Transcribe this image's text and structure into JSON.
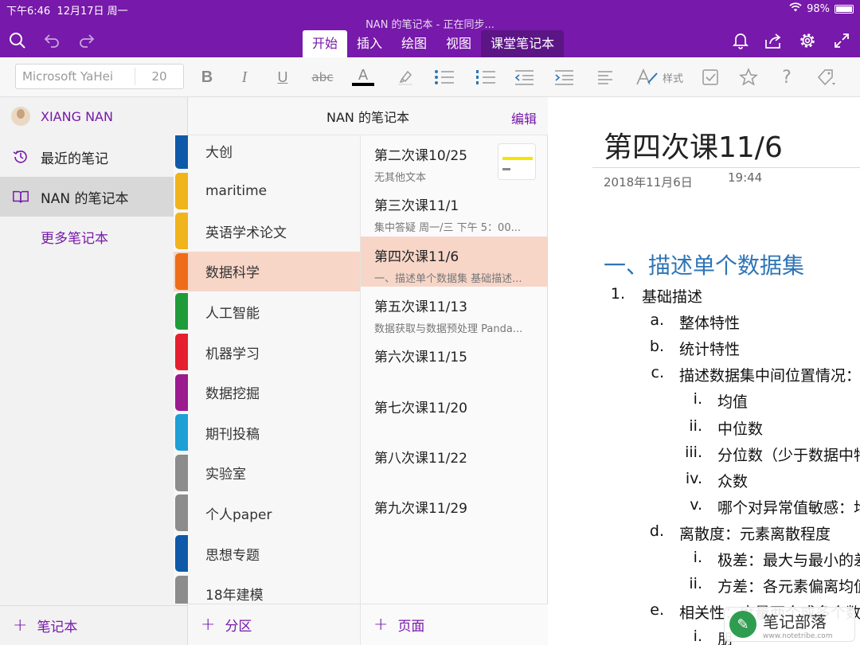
{
  "status": {
    "time": "下午6:46",
    "date": "12月17日 周一",
    "battery": "98%",
    "battery_fraction": 0.98
  },
  "header": {
    "title": "NAN 的笔记本 - 正在同步...",
    "tabs": [
      {
        "label": "开始"
      },
      {
        "label": "插入"
      },
      {
        "label": "绘图"
      },
      {
        "label": "视图"
      },
      {
        "label": "课堂笔记本"
      }
    ],
    "icons": [
      "search-icon",
      "undo-icon",
      "redo-icon",
      "bell-icon",
      "share-icon",
      "settings-icon",
      "expand-icon"
    ]
  },
  "ribbon": {
    "font_name": "Microsoft YaHei",
    "font_size": "20",
    "bold": "B",
    "italic": "I",
    "underline": "U",
    "strike": "abc",
    "font_color_letter": "A",
    "styles_label": "样式",
    "help": "?"
  },
  "nav": {
    "user": "XIANG NAN",
    "recent": "最近的笔记",
    "notebook": "NAN 的笔记本",
    "more": "更多笔记本",
    "add_notebook": "笔记本"
  },
  "sections_panel": {
    "title": "NAN 的笔记本",
    "edit": "编辑",
    "add_section": "分区",
    "items": [
      {
        "label": "大创",
        "color": "#0f5aa8"
      },
      {
        "label": "maritime",
        "color": "#f0b41c"
      },
      {
        "label": "英语学术论文",
        "color": "#f0b41c"
      },
      {
        "label": "数据科学",
        "color": "#ef6c1a"
      },
      {
        "label": "人工智能",
        "color": "#1f9b3a"
      },
      {
        "label": "机器学习",
        "color": "#e5202e"
      },
      {
        "label": "数据挖掘",
        "color": "#9b1b8e"
      },
      {
        "label": "期刊投稿",
        "color": "#1e9fd6"
      },
      {
        "label": "实验室",
        "color": "#8c8c8c"
      },
      {
        "label": "个人paper",
        "color": "#8c8c8c"
      },
      {
        "label": "思想专题",
        "color": "#0f5aa8"
      },
      {
        "label": "18年建模",
        "color": "#8c8c8c"
      }
    ]
  },
  "pages_panel": {
    "add_page": "页面",
    "items": [
      {
        "title": "第二次课10/25",
        "snippet": "无其他文本"
      },
      {
        "title": "第三次课11/1",
        "snippet": "集中答疑 周一/三 下午 5：00..."
      },
      {
        "title": "第四次课11/6",
        "snippet": "一、描述单个数据集 基础描述..."
      },
      {
        "title": "第五次课11/13",
        "snippet": "数据获取与数据预处理 Panda..."
      },
      {
        "title": "第六次课11/15",
        "snippet": ""
      },
      {
        "title": "第七次课11/20",
        "snippet": ""
      },
      {
        "title": "第八次课11/22",
        "snippet": ""
      },
      {
        "title": "第九次课11/29",
        "snippet": ""
      }
    ]
  },
  "note": {
    "title": "第四次课11/6",
    "date": "2018年11月6日",
    "time": "19:44",
    "heading": "一、描述单个数据集",
    "lines": [
      {
        "marker": "1.",
        "text": "基础描述"
      },
      {
        "marker": "a.",
        "text": "整体特性"
      },
      {
        "marker": "b.",
        "text": "统计特性"
      },
      {
        "marker": "c.",
        "text": "描述数据集中间位置情况："
      },
      {
        "marker": "i.",
        "text": "均值"
      },
      {
        "marker": "ii.",
        "text": "中位数"
      },
      {
        "marker": "iii.",
        "text": "分位数（少于数据中特"
      },
      {
        "marker": "iv.",
        "text": "众数"
      },
      {
        "marker": "v.",
        "text": "哪个对异常值敏感：均"
      },
      {
        "marker": "d.",
        "text": "离散度：元素离散程度"
      },
      {
        "marker": "i.",
        "text": "极差：最大与最小的差"
      },
      {
        "marker": "ii.",
        "text": "方差：各元素偏离均值"
      },
      {
        "marker": "e.",
        "text": "相关性：度量两个或多个数"
      },
      {
        "marker": "i.",
        "text": "朋"
      }
    ]
  },
  "watermark": {
    "name": "笔记部落",
    "url": "www.notetribe.com"
  }
}
